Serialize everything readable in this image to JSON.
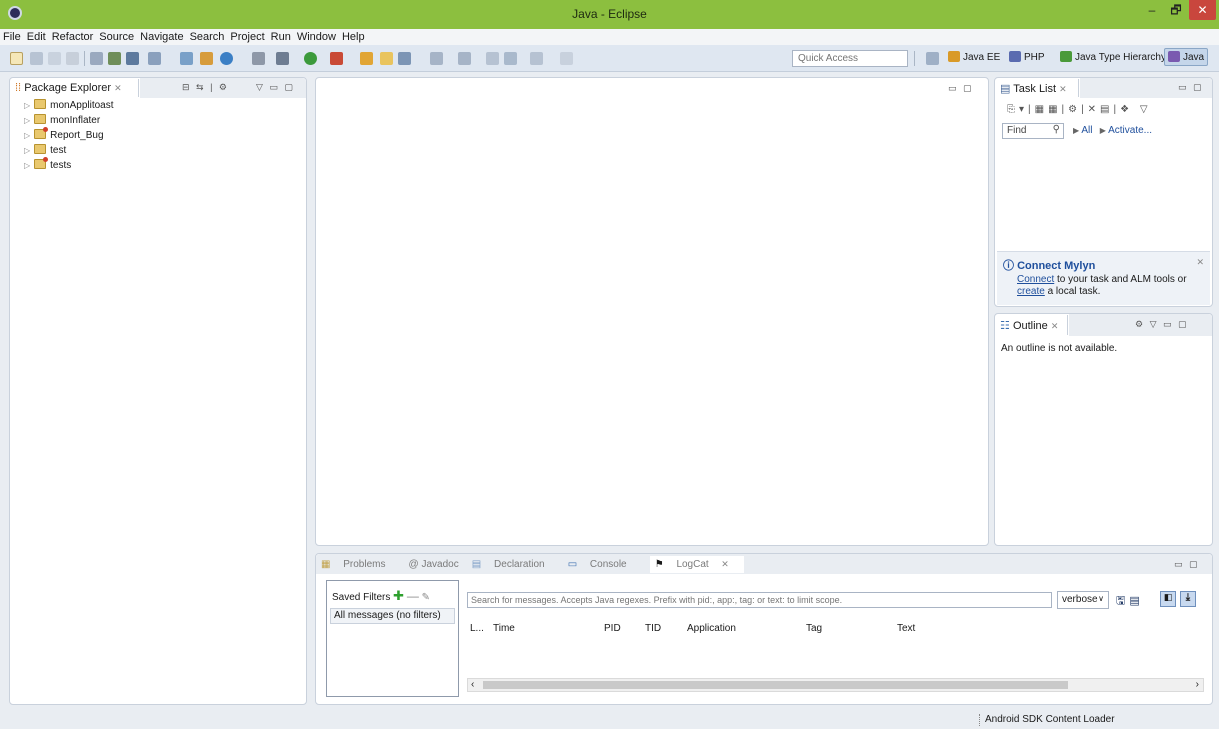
{
  "window": {
    "title": "Java - Eclipse",
    "minimize": "–",
    "restore": "🗗",
    "close": "✕"
  },
  "menu": [
    "File",
    "Edit",
    "Refactor",
    "Source",
    "Navigate",
    "Search",
    "Project",
    "Run",
    "Window",
    "Help"
  ],
  "toolbar": {
    "quick_access_placeholder": "Quick Access"
  },
  "perspectives": [
    {
      "label": "Java EE",
      "color": "#d99a28"
    },
    {
      "label": "PHP",
      "color": "#5a6bb0"
    },
    {
      "label": "Java Type Hierarchy",
      "color": "#4a9a3a"
    },
    {
      "label": "Java",
      "color": "#7a5ab0"
    }
  ],
  "package_explorer": {
    "title": "Package Explorer",
    "projects": [
      "monApplitoast",
      "monInflater",
      "Report_Bug",
      "test",
      "tests"
    ]
  },
  "task_list": {
    "title": "Task List",
    "find_placeholder": "Find",
    "all_label": "All",
    "activate_label": "Activate..."
  },
  "mylyn": {
    "title": "Connect Mylyn",
    "connect_link": "Connect",
    "connect_rest": " to your task and ALM tools or",
    "create_link": "create",
    "create_rest": " a local task."
  },
  "outline": {
    "title": "Outline",
    "message": "An outline is not available."
  },
  "bottom_tabs": [
    "Problems",
    "@ Javadoc",
    "Declaration",
    "Console",
    "LogCat"
  ],
  "logcat": {
    "saved_filters": "Saved Filters",
    "all_messages": "All messages (no filters)",
    "search_placeholder": "Search for messages. Accepts Java regexes. Prefix with pid:, app:, tag: or text: to limit scope.",
    "level": "verbose",
    "columns": [
      "L...",
      "Time",
      "PID",
      "TID",
      "Application",
      "Tag",
      "Text"
    ]
  },
  "status": {
    "right_text": "Android SDK Content Loader"
  },
  "colors": {
    "titlebar": "#8cbf3f",
    "close": "#c9463d"
  }
}
